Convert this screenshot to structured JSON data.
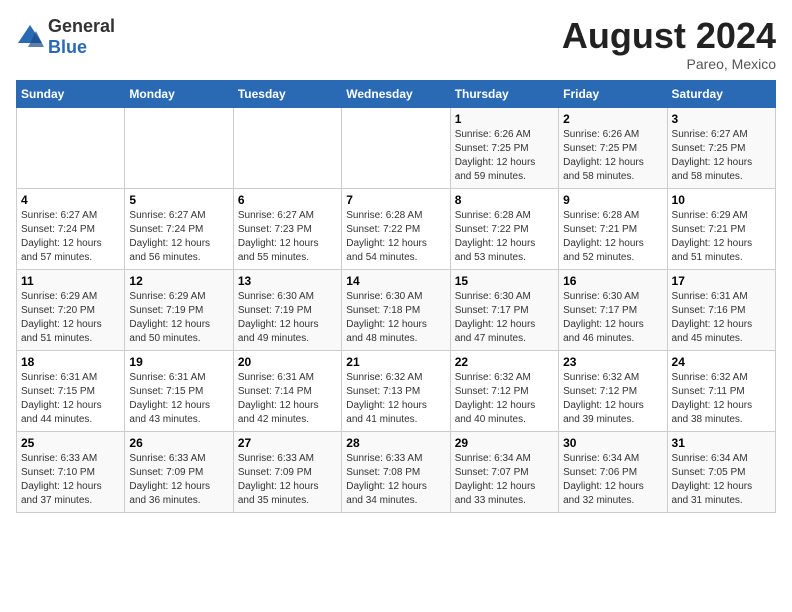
{
  "header": {
    "logo_general": "General",
    "logo_blue": "Blue",
    "month_year": "August 2024",
    "location": "Pareo, Mexico"
  },
  "calendar": {
    "weekdays": [
      "Sunday",
      "Monday",
      "Tuesday",
      "Wednesday",
      "Thursday",
      "Friday",
      "Saturday"
    ],
    "weeks": [
      [
        {
          "day": "",
          "info": ""
        },
        {
          "day": "",
          "info": ""
        },
        {
          "day": "",
          "info": ""
        },
        {
          "day": "",
          "info": ""
        },
        {
          "day": "1",
          "info": "Sunrise: 6:26 AM\nSunset: 7:25 PM\nDaylight: 12 hours and 59 minutes."
        },
        {
          "day": "2",
          "info": "Sunrise: 6:26 AM\nSunset: 7:25 PM\nDaylight: 12 hours and 58 minutes."
        },
        {
          "day": "3",
          "info": "Sunrise: 6:27 AM\nSunset: 7:25 PM\nDaylight: 12 hours and 58 minutes."
        }
      ],
      [
        {
          "day": "4",
          "info": "Sunrise: 6:27 AM\nSunset: 7:24 PM\nDaylight: 12 hours and 57 minutes."
        },
        {
          "day": "5",
          "info": "Sunrise: 6:27 AM\nSunset: 7:24 PM\nDaylight: 12 hours and 56 minutes."
        },
        {
          "day": "6",
          "info": "Sunrise: 6:27 AM\nSunset: 7:23 PM\nDaylight: 12 hours and 55 minutes."
        },
        {
          "day": "7",
          "info": "Sunrise: 6:28 AM\nSunset: 7:22 PM\nDaylight: 12 hours and 54 minutes."
        },
        {
          "day": "8",
          "info": "Sunrise: 6:28 AM\nSunset: 7:22 PM\nDaylight: 12 hours and 53 minutes."
        },
        {
          "day": "9",
          "info": "Sunrise: 6:28 AM\nSunset: 7:21 PM\nDaylight: 12 hours and 52 minutes."
        },
        {
          "day": "10",
          "info": "Sunrise: 6:29 AM\nSunset: 7:21 PM\nDaylight: 12 hours and 51 minutes."
        }
      ],
      [
        {
          "day": "11",
          "info": "Sunrise: 6:29 AM\nSunset: 7:20 PM\nDaylight: 12 hours and 51 minutes."
        },
        {
          "day": "12",
          "info": "Sunrise: 6:29 AM\nSunset: 7:19 PM\nDaylight: 12 hours and 50 minutes."
        },
        {
          "day": "13",
          "info": "Sunrise: 6:30 AM\nSunset: 7:19 PM\nDaylight: 12 hours and 49 minutes."
        },
        {
          "day": "14",
          "info": "Sunrise: 6:30 AM\nSunset: 7:18 PM\nDaylight: 12 hours and 48 minutes."
        },
        {
          "day": "15",
          "info": "Sunrise: 6:30 AM\nSunset: 7:17 PM\nDaylight: 12 hours and 47 minutes."
        },
        {
          "day": "16",
          "info": "Sunrise: 6:30 AM\nSunset: 7:17 PM\nDaylight: 12 hours and 46 minutes."
        },
        {
          "day": "17",
          "info": "Sunrise: 6:31 AM\nSunset: 7:16 PM\nDaylight: 12 hours and 45 minutes."
        }
      ],
      [
        {
          "day": "18",
          "info": "Sunrise: 6:31 AM\nSunset: 7:15 PM\nDaylight: 12 hours and 44 minutes."
        },
        {
          "day": "19",
          "info": "Sunrise: 6:31 AM\nSunset: 7:15 PM\nDaylight: 12 hours and 43 minutes."
        },
        {
          "day": "20",
          "info": "Sunrise: 6:31 AM\nSunset: 7:14 PM\nDaylight: 12 hours and 42 minutes."
        },
        {
          "day": "21",
          "info": "Sunrise: 6:32 AM\nSunset: 7:13 PM\nDaylight: 12 hours and 41 minutes."
        },
        {
          "day": "22",
          "info": "Sunrise: 6:32 AM\nSunset: 7:12 PM\nDaylight: 12 hours and 40 minutes."
        },
        {
          "day": "23",
          "info": "Sunrise: 6:32 AM\nSunset: 7:12 PM\nDaylight: 12 hours and 39 minutes."
        },
        {
          "day": "24",
          "info": "Sunrise: 6:32 AM\nSunset: 7:11 PM\nDaylight: 12 hours and 38 minutes."
        }
      ],
      [
        {
          "day": "25",
          "info": "Sunrise: 6:33 AM\nSunset: 7:10 PM\nDaylight: 12 hours and 37 minutes."
        },
        {
          "day": "26",
          "info": "Sunrise: 6:33 AM\nSunset: 7:09 PM\nDaylight: 12 hours and 36 minutes."
        },
        {
          "day": "27",
          "info": "Sunrise: 6:33 AM\nSunset: 7:09 PM\nDaylight: 12 hours and 35 minutes."
        },
        {
          "day": "28",
          "info": "Sunrise: 6:33 AM\nSunset: 7:08 PM\nDaylight: 12 hours and 34 minutes."
        },
        {
          "day": "29",
          "info": "Sunrise: 6:34 AM\nSunset: 7:07 PM\nDaylight: 12 hours and 33 minutes."
        },
        {
          "day": "30",
          "info": "Sunrise: 6:34 AM\nSunset: 7:06 PM\nDaylight: 12 hours and 32 minutes."
        },
        {
          "day": "31",
          "info": "Sunrise: 6:34 AM\nSunset: 7:05 PM\nDaylight: 12 hours and 31 minutes."
        }
      ]
    ]
  }
}
